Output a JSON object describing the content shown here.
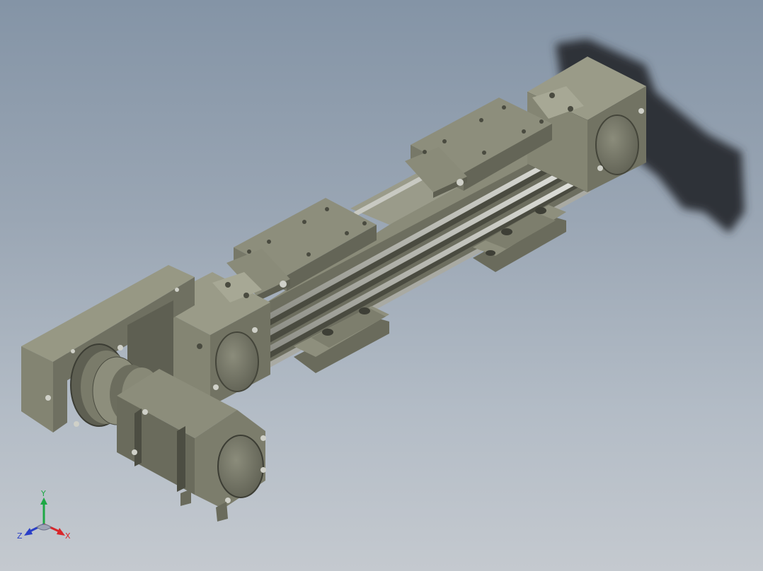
{
  "viewport": {
    "background_top": "#8494a6",
    "background_bottom": "#c4c9cf"
  },
  "model": {
    "body_color": "#7c7d6c",
    "body_dark": "#5b5c4e",
    "body_light": "#9c9d8b",
    "rail_color": "#c9cac4",
    "shadow_color": "#2f3338"
  },
  "triad": {
    "x_label": "X",
    "y_label": "Y",
    "z_label": "Z",
    "x_color": "#d8262a",
    "y_color": "#1ea845",
    "z_color": "#2a3fc7"
  }
}
